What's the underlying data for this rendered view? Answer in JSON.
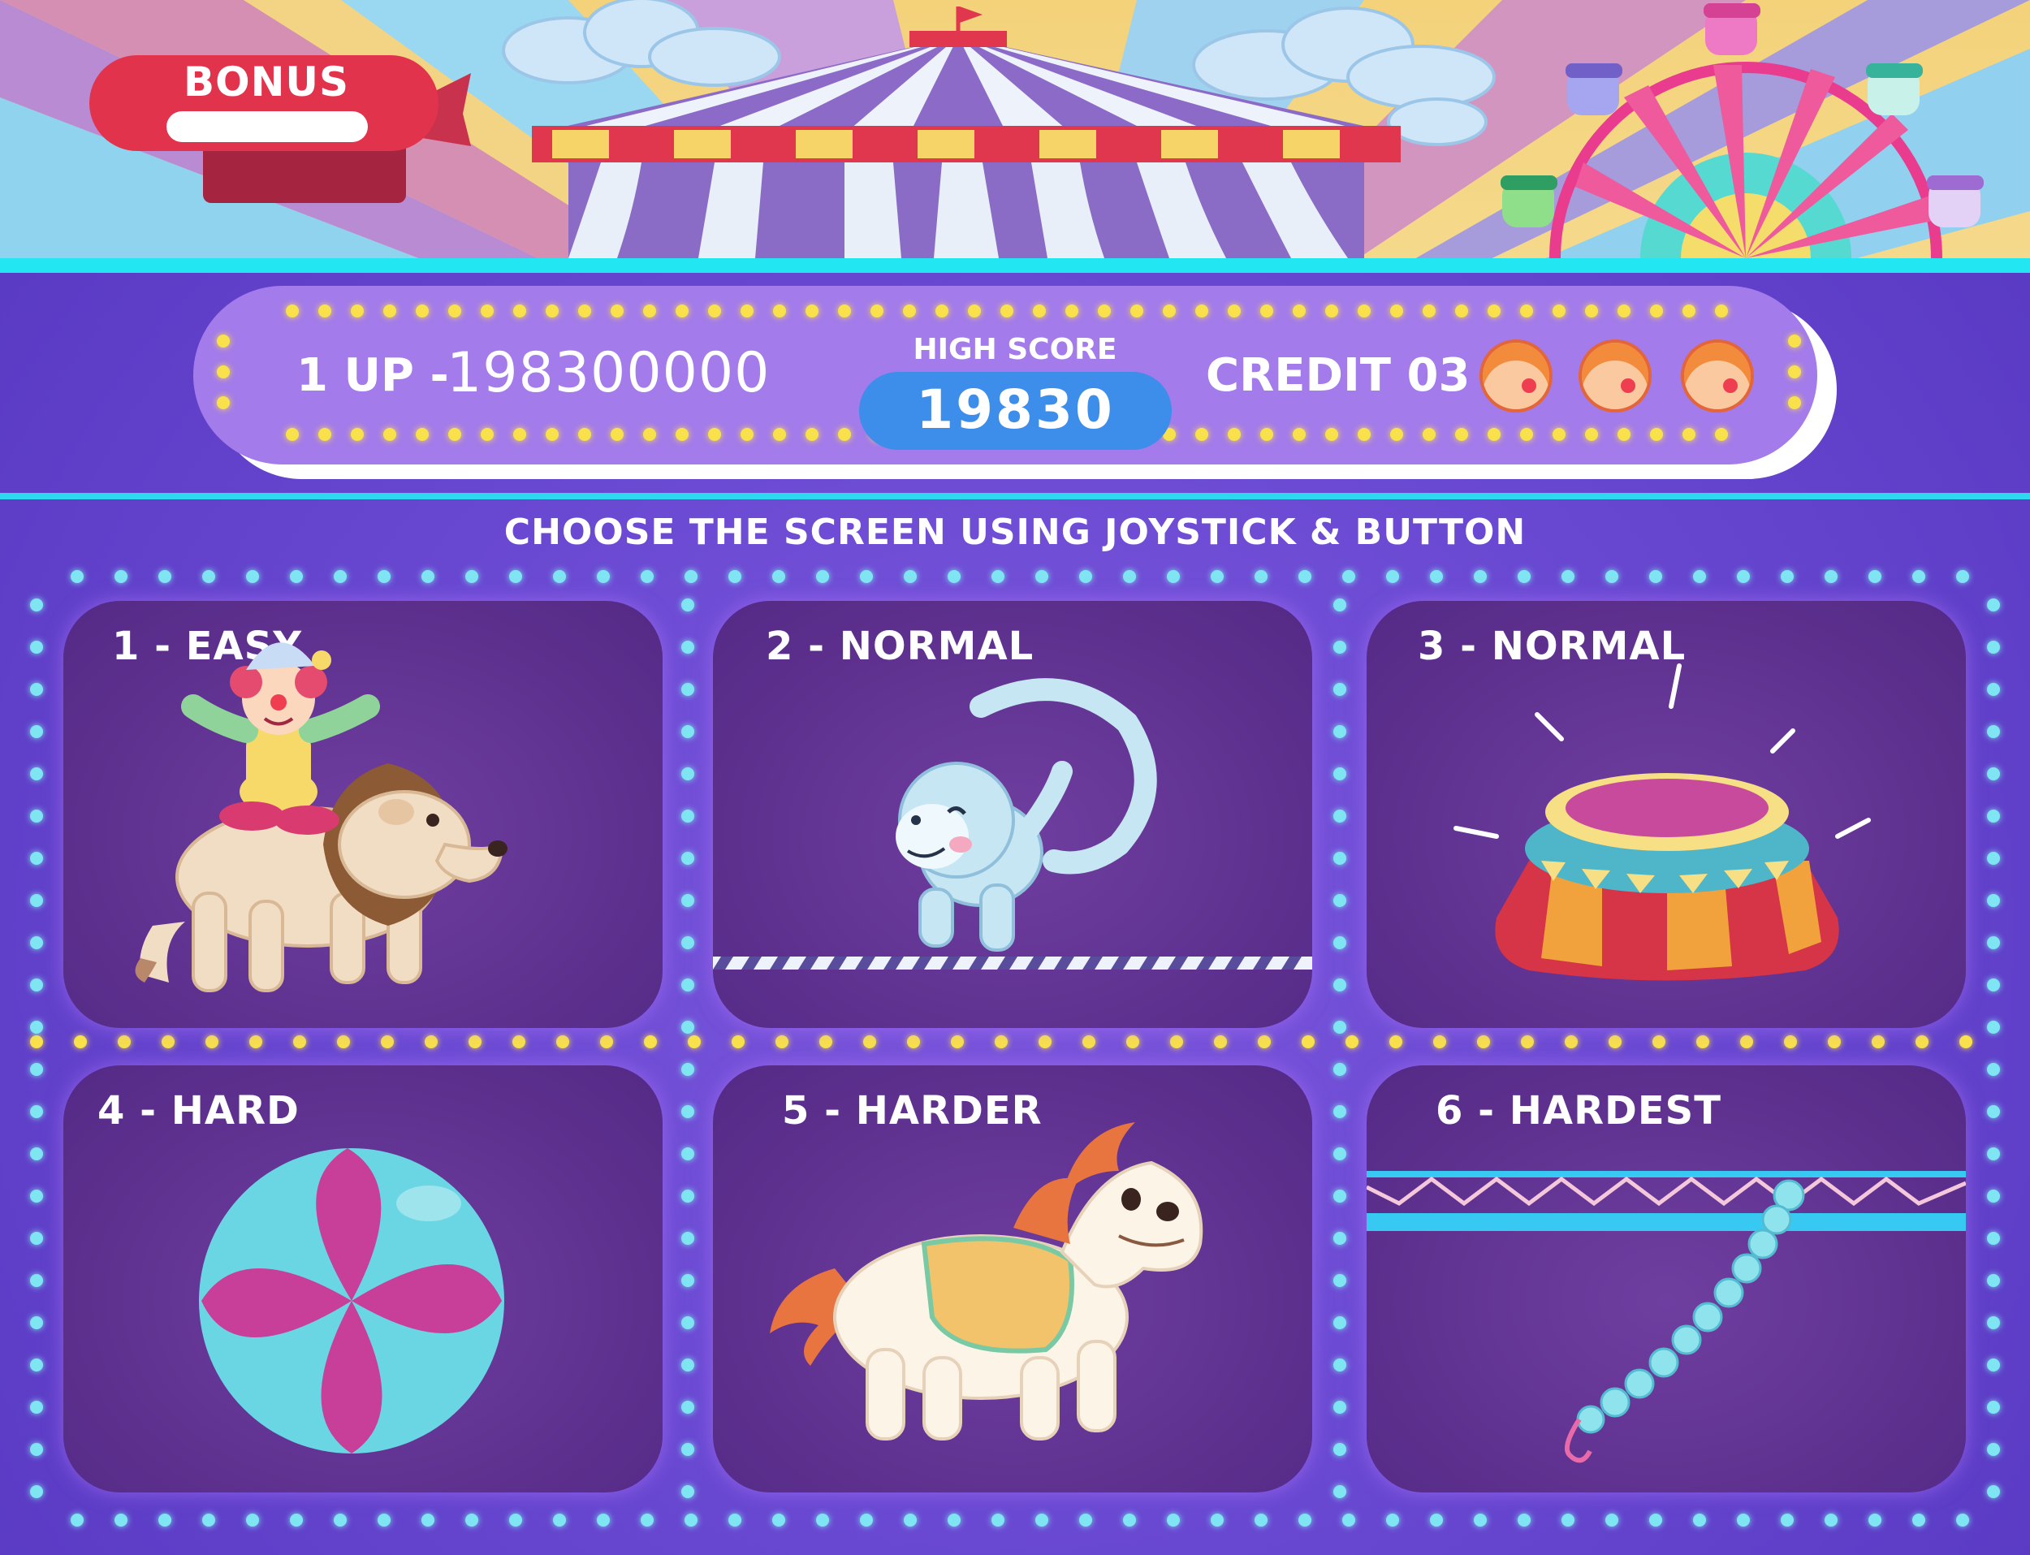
{
  "banner": {
    "bonus_label": "BONUS"
  },
  "scoreboard": {
    "player_label": "1 UP -",
    "player_score": "198300000",
    "high_score_label": "HIGH SCORE",
    "high_score_value": "19830",
    "credit_label": "CREDIT 03",
    "lives_icon": "clown-face-icon",
    "lives_count": 3
  },
  "instruction": "CHOOSE THE SCREEN USING JOYSTICK & BUTTON",
  "levels": [
    {
      "label": "1 - EASY",
      "icon": "clown-riding-lion-icon"
    },
    {
      "label": "2 - NORMAL",
      "icon": "monkey-tightrope-icon"
    },
    {
      "label": "3 - NORMAL",
      "icon": "circus-podium-icon"
    },
    {
      "label": "4 - HARD",
      "icon": "beach-ball-icon"
    },
    {
      "label": "5 - HARDER",
      "icon": "pony-icon"
    },
    {
      "label": "6 - HARDEST",
      "icon": "trapeze-rope-icon"
    }
  ],
  "colors": {
    "background": "#6a49d2",
    "card": "#5c2f8d",
    "accent_cyan": "#22e6f2",
    "high_score_box": "#3d8eea",
    "bonus_red": "#e2334c"
  }
}
